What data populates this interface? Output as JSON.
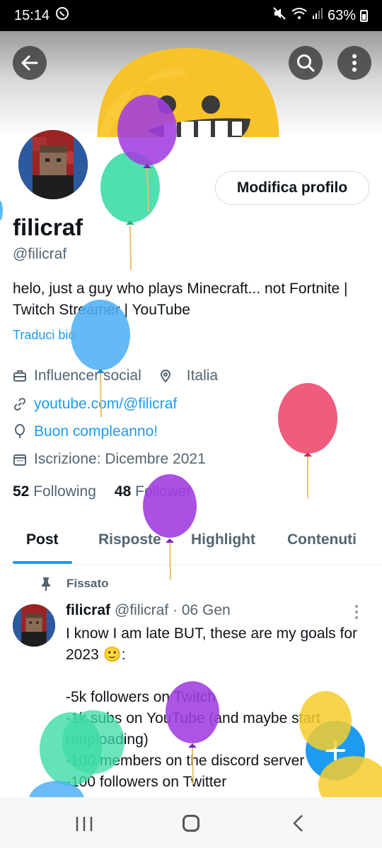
{
  "status_bar": {
    "time": "15:14",
    "battery": "63%"
  },
  "profile": {
    "name": "filicraf",
    "handle": "@filicraf",
    "bio": "helo, just a guy who plays Minecraft... not Fortnite | Twitch Streamer | YouTube",
    "translate_label": "Traduci bio",
    "edit_button": "Modifica profilo",
    "category": "Influencer social",
    "location": "Italia",
    "website": "youtube.com/@filicraf",
    "birthday": "Buon compleanno!",
    "joined": "Iscrizione: Dicembre 2021",
    "following_count": "52",
    "following_label": "Following",
    "followers_count": "48",
    "followers_label": "Follower"
  },
  "tabs": [
    {
      "label": "Post",
      "active": true
    },
    {
      "label": "Risposte",
      "active": false
    },
    {
      "label": "Highlight",
      "active": false
    },
    {
      "label": "Contenuti",
      "active": false
    }
  ],
  "pinned_post": {
    "pinned_label": "Fissato",
    "author": "filicraf",
    "meta": "@filicraf · 06 Gen",
    "text": "I know I am late BUT, these are my goals for 2023 🙂:\n\n-5k followers on Twitch\n-1k subs on YouTube (and maybe start reuploading)\n-100 members on the discord server\n-100 followers on Twitter"
  },
  "colors": {
    "accent": "#1d9bf0",
    "text": "#0f1419",
    "secondary": "#536471"
  },
  "icons": [
    "back-arrow-icon",
    "search-icon",
    "more-vertical-icon",
    "briefcase-icon",
    "location-pin-icon",
    "link-icon",
    "balloon-icon",
    "calendar-icon",
    "pin-icon",
    "compose-plus-icon"
  ]
}
